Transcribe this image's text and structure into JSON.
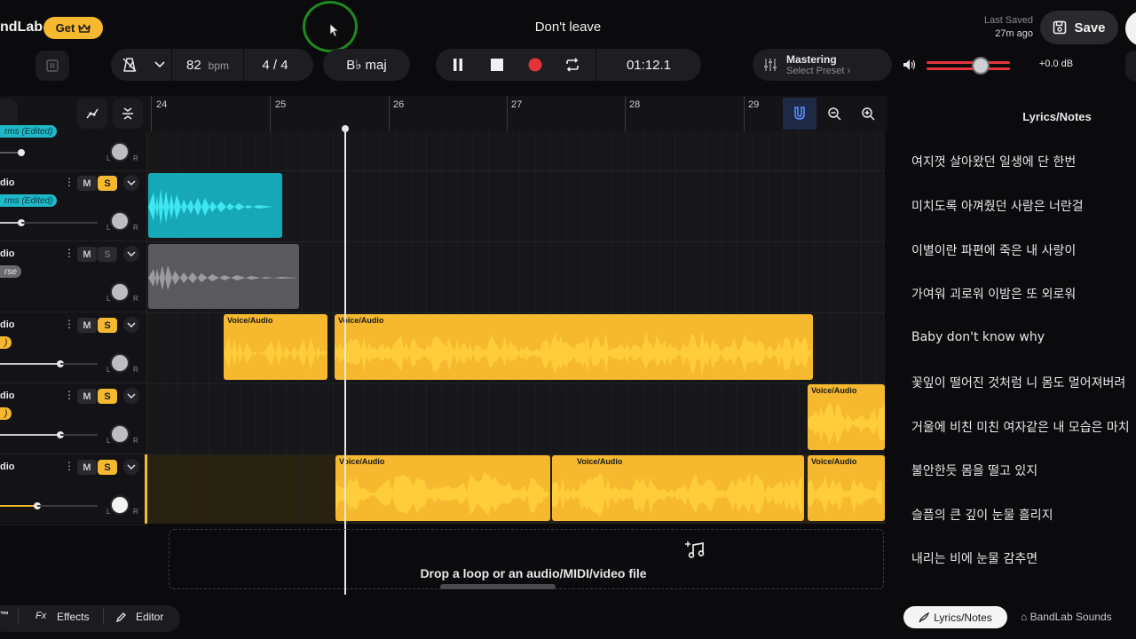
{
  "header": {
    "logo_text": "ndLab",
    "get_label": "Get",
    "song_title": "Don't leave",
    "last_saved_label": "Last Saved",
    "last_saved_ago": "27m ago",
    "save_label": "Save"
  },
  "transport": {
    "bpm_value": "82",
    "bpm_unit": "bpm",
    "time_signature": "4 / 4",
    "key": "B♭ maj",
    "time": "01:12.1"
  },
  "mastering": {
    "title": "Mastering",
    "subtitle": "Select Preset"
  },
  "volume": {
    "db_readout": "+0.0 dB",
    "level_fraction": 0.65
  },
  "ruler": {
    "bars": [
      "24",
      "25",
      "26",
      "27",
      "28",
      "29"
    ]
  },
  "tracks": [
    {
      "name": "",
      "tag": "rms (Edited)",
      "tag_color": "#1fb8c8"
    },
    {
      "name": "dio",
      "tag": "rms (Edited)",
      "tag_color": "#1fb8c8",
      "mute": "M",
      "solo": "S"
    },
    {
      "name": "dio",
      "tag": "rse",
      "tag_color": "#6a6a70",
      "mute": "M",
      "solo": "S"
    },
    {
      "name": "dio",
      "tag": ")",
      "tag_color": "#f5b82e",
      "mute": "M",
      "solo": "S"
    },
    {
      "name": "dio",
      "tag": ")",
      "tag_color": "#f5b82e",
      "mute": "M",
      "solo": "S"
    },
    {
      "name": "dio",
      "tag": "",
      "tag_color": "#f5b82e",
      "mute": "M",
      "solo": "S"
    }
  ],
  "knob_left": "L",
  "knob_right": "R",
  "clips": [
    {
      "label": "Voice/Audio"
    },
    {
      "label": "Voice/Audio"
    },
    {
      "label": "Voice/Audio"
    },
    {
      "label": "Voice/Audio"
    },
    {
      "label": "Voice/Audio"
    },
    {
      "label": "Voice/Audio"
    }
  ],
  "drop_zone_text": "Drop a loop or an audio/MIDI/video file",
  "lyrics": {
    "title": "Lyrics/Notes",
    "lines": [
      "여지껏 살아왔던 일생에 단 한번",
      "미치도록 아껴줬던 사람은 너란걸",
      "이별이란 파편에 죽은 내 사랑이",
      "가여워 괴로워 이밤은 또 외로워",
      "Baby don't know why",
      "꽃잎이 떨어진 것처럼 니 몸도 멀어져버려",
      "거울에 비친 미친 여자같은 내 모습은 마치",
      "불안한듯 몸을 떨고 있지",
      "슬픔의 큰 깊이 눈물 흘리지",
      "내리는 비에 눈물 감추면"
    ]
  },
  "bottom": {
    "mark": "™",
    "fx_glyph": "Fx",
    "effects_label": "Effects",
    "editor_label": "Editor",
    "tab_lyrics": "Lyrics/Notes",
    "tab_sounds": "BandLab Sounds"
  },
  "colors": {
    "accent": "#f5b82e",
    "teal": "#1fb8c8",
    "record": "#e5333a",
    "background": "#0b0b0d"
  }
}
